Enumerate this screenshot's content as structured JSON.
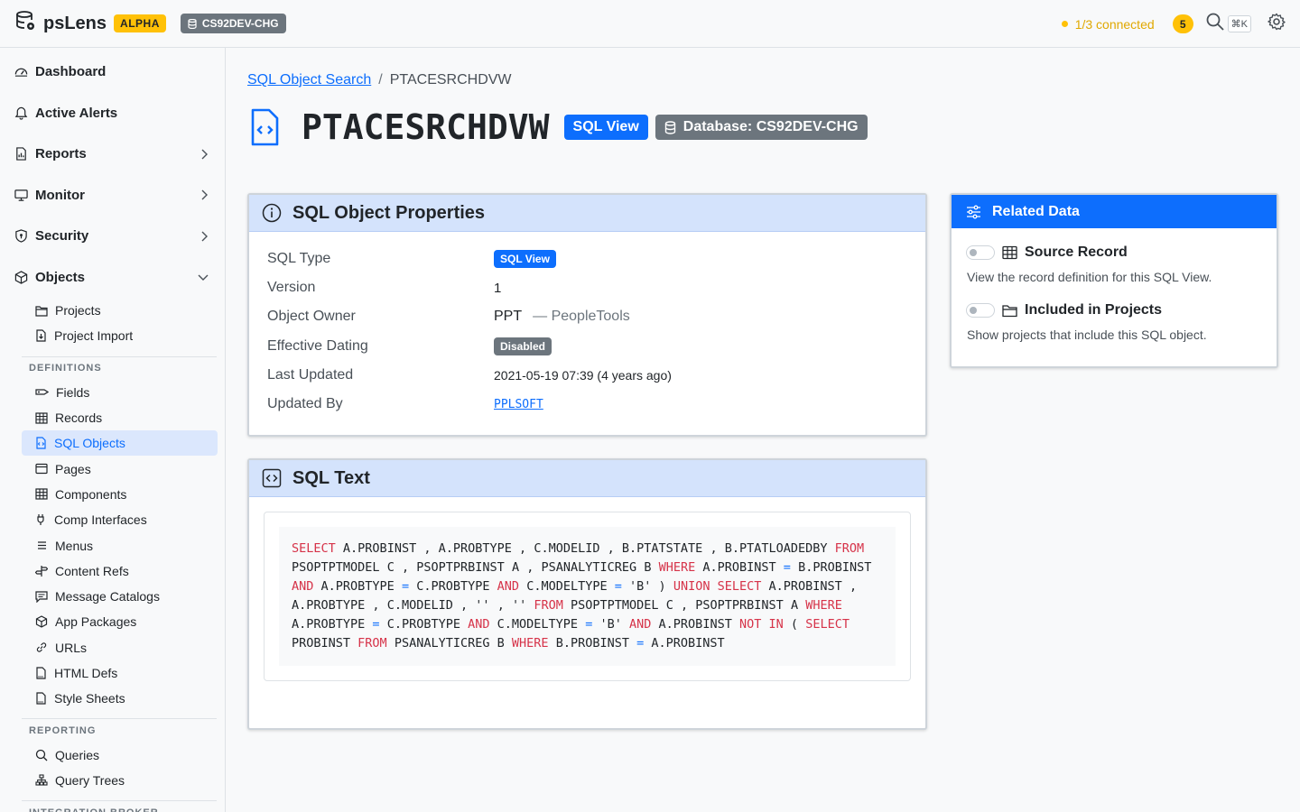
{
  "app": {
    "name": "psLens",
    "badge": "ALPHA",
    "database": "CS92DEV-CHG"
  },
  "topbar": {
    "connection": "1/3 connected",
    "notifications": "5",
    "shortcut": "⌘K"
  },
  "sidebar": {
    "top": [
      {
        "label": "Dashboard"
      },
      {
        "label": "Active Alerts"
      },
      {
        "label": "Reports"
      },
      {
        "label": "Monitor"
      },
      {
        "label": "Security"
      },
      {
        "label": "Objects"
      }
    ],
    "objects_items": [
      {
        "label": "Projects"
      },
      {
        "label": "Project Import"
      }
    ],
    "definitions_label": "DEFINITIONS",
    "definitions": [
      {
        "label": "Fields"
      },
      {
        "label": "Records"
      },
      {
        "label": "SQL Objects"
      },
      {
        "label": "Pages"
      },
      {
        "label": "Components"
      },
      {
        "label": "Comp Interfaces"
      },
      {
        "label": "Menus"
      },
      {
        "label": "Content Refs"
      },
      {
        "label": "Message Catalogs"
      },
      {
        "label": "App Packages"
      },
      {
        "label": "URLs"
      },
      {
        "label": "HTML Defs"
      },
      {
        "label": "Style Sheets"
      }
    ],
    "reporting_label": "REPORTING",
    "reporting": [
      {
        "label": "Queries"
      },
      {
        "label": "Query Trees"
      }
    ],
    "integration_label": "INTEGRATION BROKER"
  },
  "breadcrumb": {
    "parent": "SQL Object Search",
    "sep": "/",
    "current": "PTACESRCHDVW"
  },
  "page": {
    "title": "PTACESRCHDVW",
    "type_badge": "SQL View",
    "db_badge": "Database: CS92DEV-CHG"
  },
  "properties": {
    "heading": "SQL Object Properties",
    "rows": {
      "sql_type": {
        "label": "SQL Type",
        "value": "SQL View"
      },
      "version": {
        "label": "Version",
        "value": "1"
      },
      "owner": {
        "label": "Object Owner",
        "value": "PPT",
        "extra": "— PeopleTools"
      },
      "eff_dating": {
        "label": "Effective Dating",
        "value": "Disabled"
      },
      "last_updated": {
        "label": "Last Updated",
        "value": "2021-05-19 07:39 (4 years ago)"
      },
      "updated_by": {
        "label": "Updated By",
        "value": "PPLSOFT"
      }
    }
  },
  "sql_text": {
    "heading": "SQL Text",
    "code": "SELECT A.PROBINST , A.PROBTYPE , C.MODELID , B.PTATSTATE , B.PTATLOADEDBY FROM PSOPTPTMODEL C , PSOPTPRBINST A , PSANALYTICREG B WHERE A.PROBINST = B.PROBINST AND A.PROBTYPE = C.PROBTYPE AND C.MODELTYPE = 'B' ) UNION SELECT A.PROBINST , A.PROBTYPE , C.MODELID , '' , '' FROM PSOPTPTMODEL C , PSOPTPRBINST A WHERE A.PROBTYPE = C.PROBTYPE AND C.MODELTYPE = 'B' AND A.PROBINST NOT IN ( SELECT PROBINST FROM PSANALYTICREG B WHERE B.PROBINST = A.PROBINST"
  },
  "related": {
    "heading": "Related Data",
    "items": [
      {
        "title": "Source Record",
        "desc": "View the record definition for this SQL View."
      },
      {
        "title": "Included in Projects",
        "desc": "Show projects that include this SQL object."
      }
    ]
  }
}
